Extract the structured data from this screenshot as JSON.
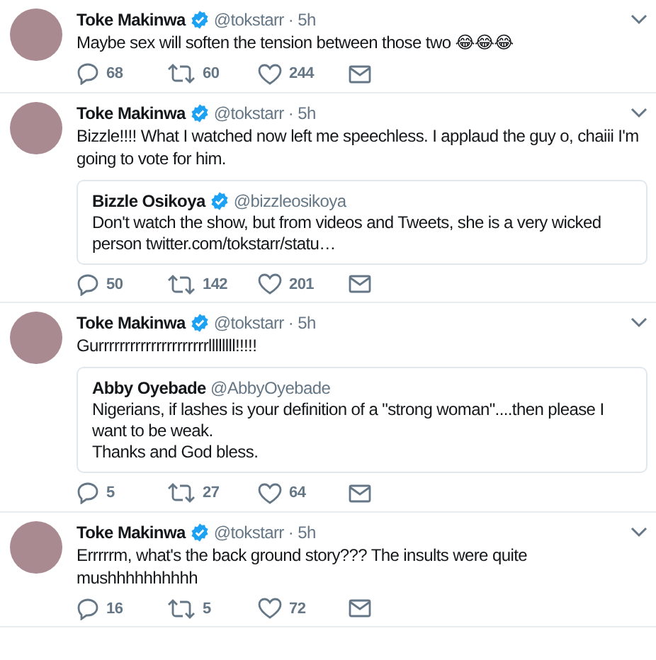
{
  "tweets": [
    {
      "author": {
        "name": "Toke Makinwa",
        "verified": true,
        "handle": "@tokstarr"
      },
      "separator": "·",
      "time": "5h",
      "text": "Maybe sex will soften the tension between those two 😂😂😂",
      "actions": {
        "replies": "68",
        "retweets": "60",
        "likes": "244"
      }
    },
    {
      "author": {
        "name": "Toke Makinwa",
        "verified": true,
        "handle": "@tokstarr"
      },
      "separator": "·",
      "time": "5h",
      "text": "Bizzle!!!! What I watched now left me speechless. I applaud the guy o, chaiii I'm going to vote for him.",
      "quote": {
        "author": {
          "name": "Bizzle Osikoya",
          "verified": true,
          "handle": "@bizzleosikoya"
        },
        "lines": [
          "Don't watch the show, but from videos and Tweets, she is a very wicked person twitter.com/tokstarr/statu…"
        ]
      },
      "actions": {
        "replies": "50",
        "retweets": "142",
        "likes": "201"
      }
    },
    {
      "author": {
        "name": "Toke Makinwa",
        "verified": true,
        "handle": "@tokstarr"
      },
      "separator": "·",
      "time": "5h",
      "text": "Gurrrrrrrrrrrrrrrrrrrrrllllllll!!!!!",
      "quote": {
        "author": {
          "name": "Abby Oyebade",
          "verified": false,
          "handle": "@AbbyOyebade"
        },
        "lines": [
          "Nigerians, if lashes is your definition of a \"strong woman\"....then please I want to be weak.",
          "Thanks and God bless."
        ]
      },
      "actions": {
        "replies": "5",
        "retweets": "27",
        "likes": "64"
      }
    },
    {
      "author": {
        "name": "Toke Makinwa",
        "verified": true,
        "handle": "@tokstarr"
      },
      "separator": "·",
      "time": "5h",
      "text": "Errrrrm, what's the back ground story??? The insults were quite mushhhhhhhhhh",
      "actions": {
        "replies": "16",
        "retweets": "5",
        "likes": "72"
      }
    }
  ]
}
